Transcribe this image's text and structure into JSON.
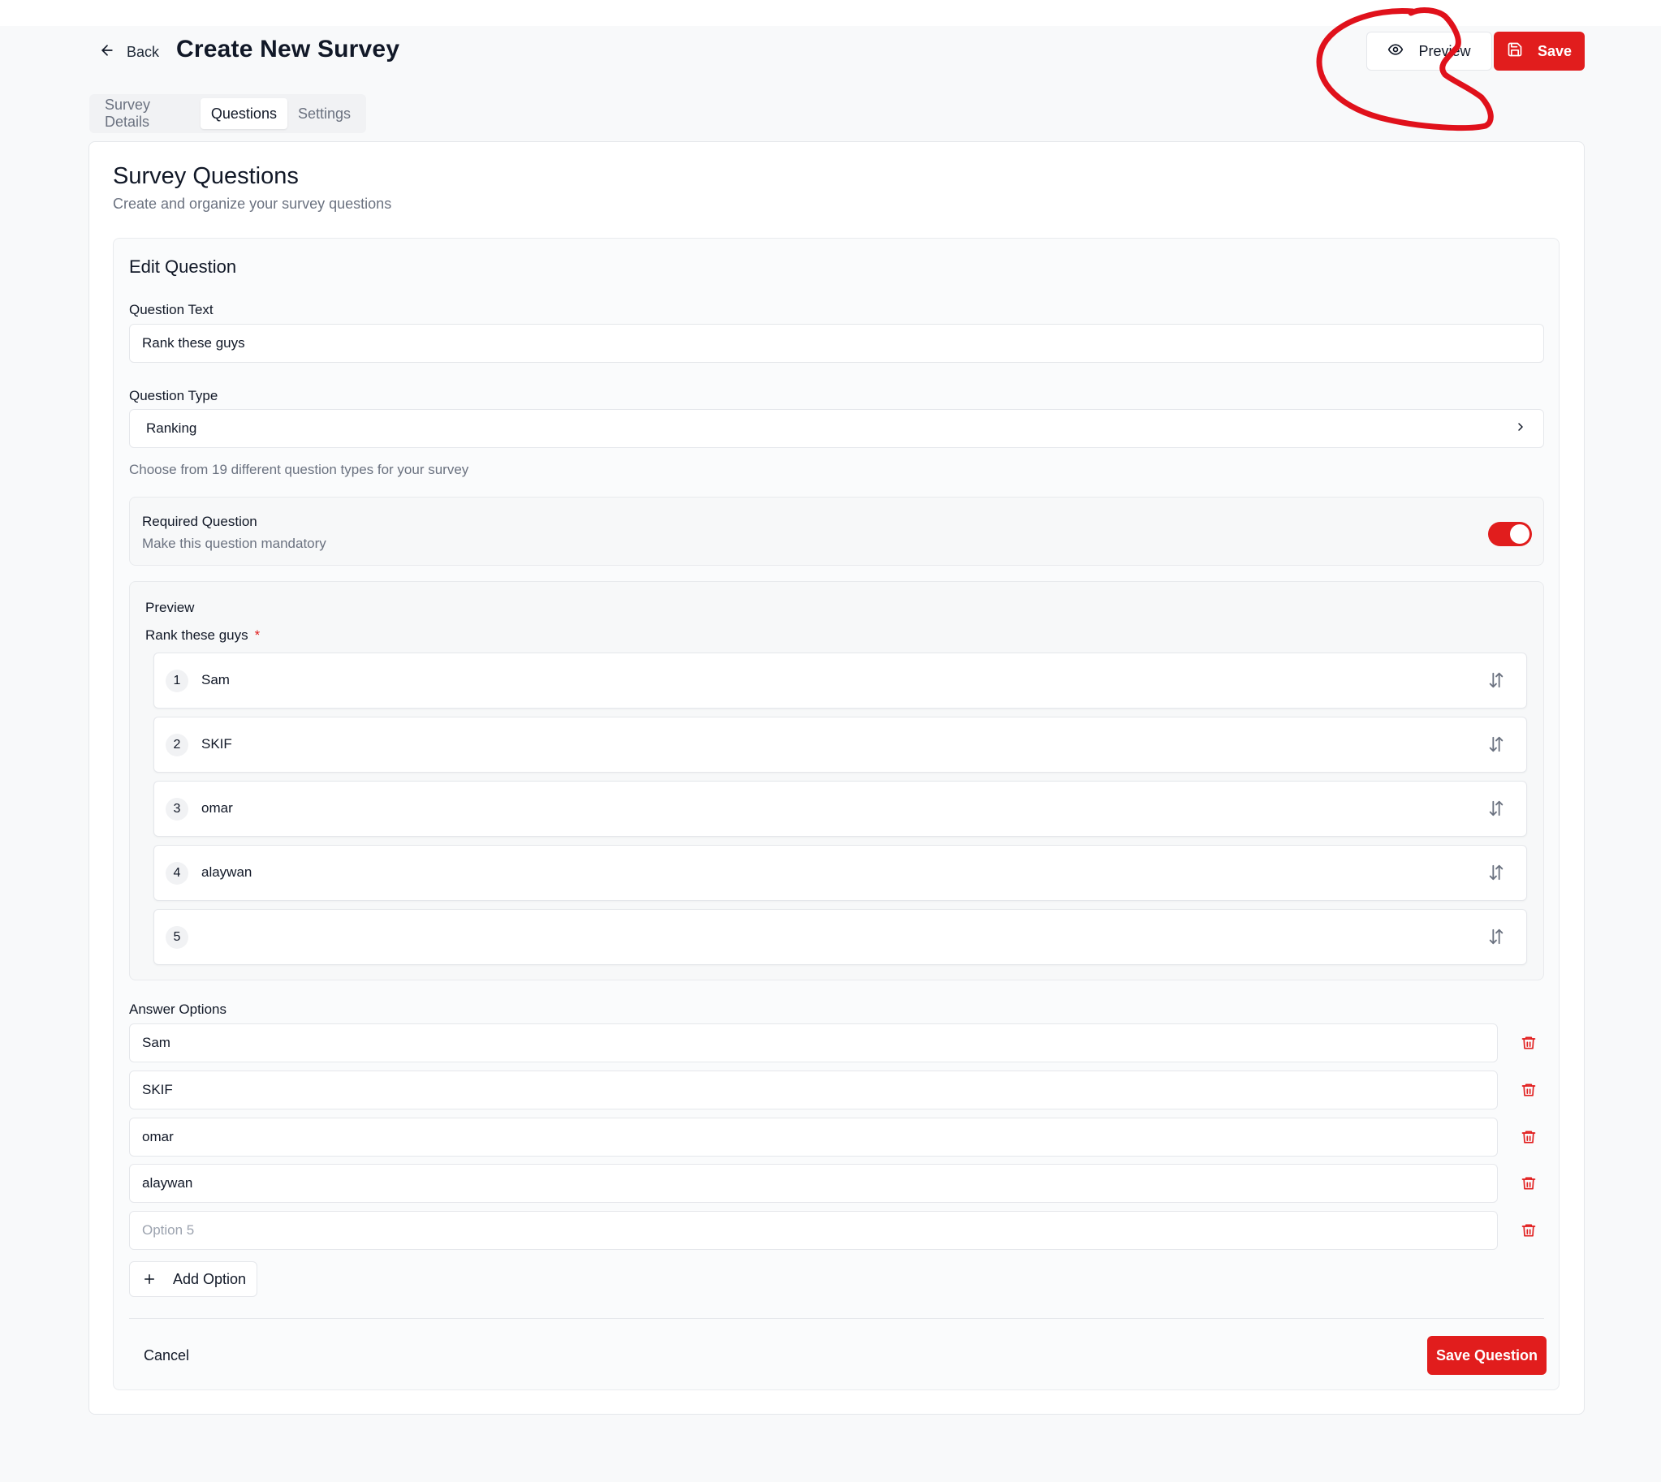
{
  "header": {
    "back_label": "Back",
    "title": "Create New Survey",
    "preview_label": "Preview",
    "save_label": "Save"
  },
  "tabs": [
    {
      "label": "Survey Details",
      "active": false
    },
    {
      "label": "Questions",
      "active": true
    },
    {
      "label": "Settings",
      "active": false
    }
  ],
  "card": {
    "title": "Survey Questions",
    "subtitle": "Create and organize your survey questions"
  },
  "editor": {
    "title": "Edit Question",
    "question_text_label": "Question Text",
    "question_text_value": "Rank these guys",
    "question_type_label": "Question Type",
    "question_type_value": "Ranking",
    "question_type_helper": "Choose from 19 different question types for your survey",
    "required_title": "Required Question",
    "required_sub": "Make this question mandatory",
    "required_on": true,
    "preview_label": "Preview",
    "preview_question": "Rank these guys",
    "preview_required_mark": "*",
    "ranking_items": [
      {
        "num": "1",
        "label": "Sam"
      },
      {
        "num": "2",
        "label": "SKIF"
      },
      {
        "num": "3",
        "label": "omar"
      },
      {
        "num": "4",
        "label": "alaywan"
      },
      {
        "num": "5",
        "label": ""
      }
    ],
    "answer_options_label": "Answer Options",
    "options": [
      {
        "value": "Sam",
        "placeholder": ""
      },
      {
        "value": "SKIF",
        "placeholder": ""
      },
      {
        "value": "omar",
        "placeholder": ""
      },
      {
        "value": "alaywan",
        "placeholder": ""
      },
      {
        "value": "",
        "placeholder": "Option 5"
      }
    ],
    "add_option_label": "Add Option",
    "cancel_label": "Cancel",
    "save_question_label": "Save Question"
  },
  "icons": {
    "back": "arrow-left-icon",
    "preview": "eye-icon",
    "save": "floppy-disk-icon",
    "select": "chevron-right-icon",
    "rank_handle": "arrow-up-down-icon",
    "delete": "trash-icon",
    "add": "plus-icon"
  },
  "colors": {
    "accent": "#e11d1d",
    "annotation": "#e0111b"
  }
}
